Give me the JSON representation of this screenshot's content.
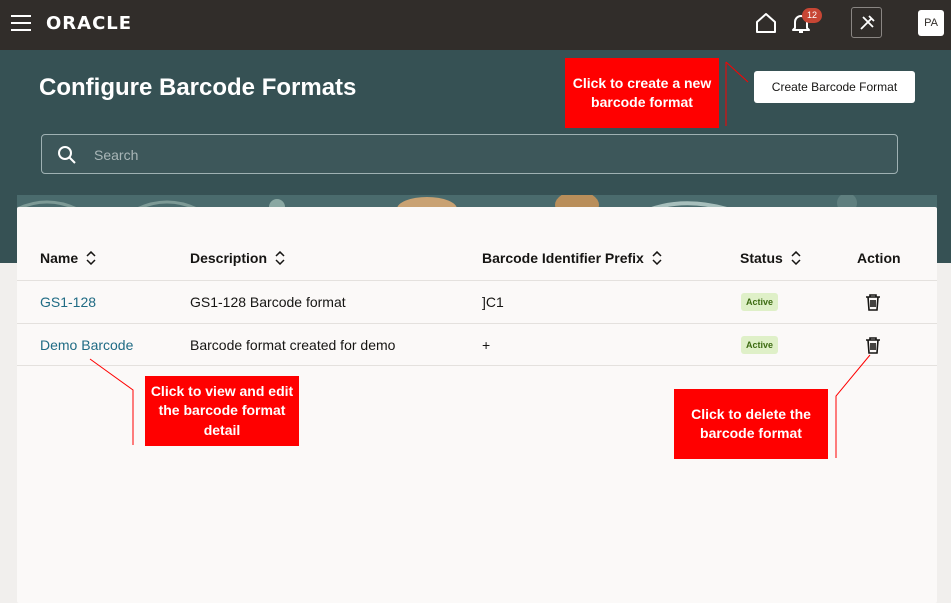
{
  "topbar": {
    "logo": "ORACLE",
    "notification_count": "12",
    "avatar_initials": "PA"
  },
  "page": {
    "title": "Configure Barcode Formats",
    "create_button": "Create Barcode Format",
    "search_placeholder": "Search"
  },
  "table": {
    "columns": [
      "Name",
      "Description",
      "Barcode Identifier Prefix",
      "Status",
      "Action"
    ],
    "rows": [
      {
        "name": "GS1-128",
        "description": "GS1-128 Barcode format",
        "prefix": "]C1",
        "status": "Active"
      },
      {
        "name": "Demo Barcode",
        "description": "Barcode format created for demo",
        "prefix": "+",
        "status": "Active"
      }
    ]
  },
  "annotations": {
    "create": "Click to create a new barcode format",
    "view": "Click to view and edit the barcode format detail",
    "delete": "Click to delete the barcode format"
  },
  "colors": {
    "topbar": "#312d2a",
    "header": "#365154",
    "link": "#1f6b84",
    "callout": "#ff0000",
    "badge": "#c74634",
    "status_bg": "#dff0c8"
  }
}
